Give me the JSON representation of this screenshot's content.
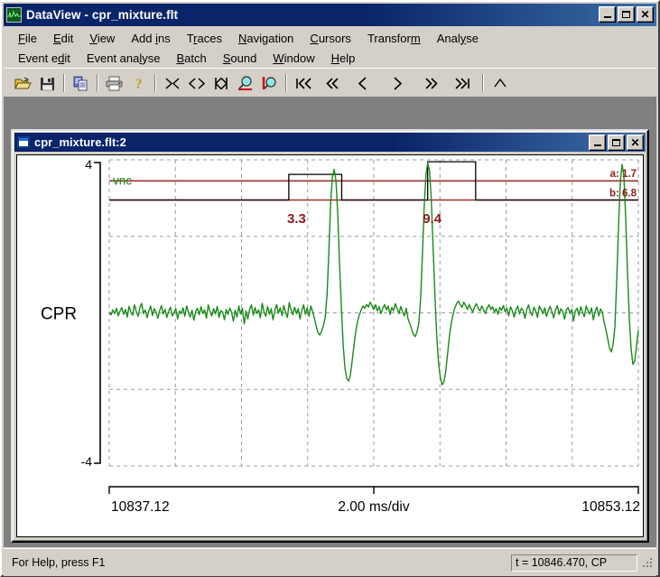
{
  "app": {
    "title": "DataView - cpr_mixture.flt",
    "icon": "waveform-icon"
  },
  "window_buttons": {
    "minimize": "_",
    "maximize": "□",
    "close": "✕"
  },
  "menu": {
    "row1": [
      {
        "label": "File",
        "accel": "F"
      },
      {
        "label": "Edit",
        "accel": "E"
      },
      {
        "label": "View",
        "accel": "V"
      },
      {
        "label": "Add ins",
        "accel": "i"
      },
      {
        "label": "Traces",
        "accel": "r"
      },
      {
        "label": "Navigation",
        "accel": "N"
      },
      {
        "label": "Cursors",
        "accel": "C"
      },
      {
        "label": "Transform",
        "accel": "m"
      },
      {
        "label": "Analyse",
        "accel": "y"
      }
    ],
    "row2": [
      {
        "label": "Event edit",
        "accel": "d"
      },
      {
        "label": "Event analyse",
        "accel": "l"
      },
      {
        "label": "Batch",
        "accel": "B"
      },
      {
        "label": "Sound",
        "accel": "S"
      },
      {
        "label": "Window",
        "accel": "W"
      },
      {
        "label": "Help",
        "accel": "H"
      }
    ]
  },
  "toolbar": {
    "buttons": [
      {
        "name": "open-file-icon",
        "kind": "icon"
      },
      {
        "name": "save-file-icon",
        "kind": "icon"
      },
      {
        "name": "separator",
        "kind": "sep"
      },
      {
        "name": "copy-icon",
        "kind": "icon"
      },
      {
        "name": "separator",
        "kind": "sep"
      },
      {
        "name": "print-icon",
        "kind": "icon"
      },
      {
        "name": "help-question-icon",
        "kind": "icon"
      },
      {
        "name": "separator",
        "kind": "sep"
      },
      {
        "name": "zoom-in-x-icon",
        "glyph": "><",
        "kind": "glyph"
      },
      {
        "name": "zoom-out-x-icon",
        "glyph": "<>",
        "kind": "glyph"
      },
      {
        "name": "fit-x-icon",
        "glyph": "K͆",
        "kind": "glyph"
      },
      {
        "name": "zoom-out-magnifier-icon",
        "kind": "icon"
      },
      {
        "name": "zoom-in-magnifier-icon",
        "kind": "icon"
      },
      {
        "name": "separator",
        "kind": "sep"
      },
      {
        "name": "go-first-icon",
        "glyph": "❘«",
        "kind": "glyph"
      },
      {
        "name": "page-back-icon",
        "glyph": "«",
        "kind": "glyph"
      },
      {
        "name": "step-back-icon",
        "glyph": "‹",
        "kind": "glyph"
      },
      {
        "name": "step-forward-icon",
        "glyph": "›",
        "kind": "glyph"
      },
      {
        "name": "page-forward-icon",
        "glyph": "»",
        "kind": "glyph"
      },
      {
        "name": "go-last-icon",
        "glyph": "»❘",
        "kind": "glyph"
      },
      {
        "name": "separator",
        "kind": "sep"
      },
      {
        "name": "chevron-up-icon",
        "glyph": "^",
        "kind": "glyph"
      }
    ]
  },
  "child_window": {
    "title": "cpr_mixture.flt:2",
    "icon": "document-window-icon"
  },
  "status": {
    "help_text": "For Help, press F1",
    "coordinate_text": "t = 10846.470, CP"
  },
  "chart_data": {
    "type": "line",
    "title": "",
    "ylabel": "CPR",
    "xlabel": "2.00  ms/div",
    "x_start_label": "10837.12",
    "x_end_label": "10853.12",
    "ms_per_div": "2.00  ms/div",
    "ylim": [
      -4,
      4
    ],
    "y_tick_labels": [
      "4",
      "-4"
    ],
    "xlim": [
      10837.12,
      10853.12
    ],
    "grid": true,
    "grid_x_divisions": 8,
    "grid_y_divisions": 4,
    "trace_name": "vnc",
    "trace_color": "#1a8a1a",
    "cursor_color": "#a03030",
    "event_color": "#000000",
    "label_color": "#8b1a1a",
    "event_labels": [
      {
        "text": "3.3",
        "t": 10842.5
      },
      {
        "text": "9.4",
        "t": 10846.6
      }
    ],
    "cursor_labels": [
      {
        "text": "a: 1.7",
        "y": 3.55
      },
      {
        "text": "b: 6.8",
        "y": 3.05
      }
    ],
    "cursor_lines_y": [
      3.45,
      2.95
    ],
    "event_pulses": [
      {
        "start": 10842.55,
        "end": 10844.15,
        "level_low": 2.95,
        "level_high": 3.62
      },
      {
        "start": 10846.75,
        "end": 10848.2,
        "level_low": 2.95,
        "level_high": 3.95
      }
    ],
    "waveform_note": "Noisy CPR neural recording with three large biphasic spikes",
    "series": [
      {
        "name": "CPR",
        "values": [
          0.02,
          -0.05,
          0.08,
          -0.02,
          0.12,
          -0.08,
          0.05,
          0.14,
          -0.04,
          0.09,
          -0.11,
          0.17,
          0.02,
          -0.06,
          0.21,
          0.04,
          -0.09,
          0.13,
          0.25,
          -0.02,
          0.08,
          -0.13,
          0.05,
          0.18,
          -0.07,
          0.11,
          0.02,
          -0.14,
          0.06,
          0.19,
          -0.03,
          0.09,
          -0.12,
          0.04,
          0.15,
          -0.08,
          0.02,
          0.11,
          -0.16,
          0.05,
          -0.02,
          0.13,
          -0.09,
          0.18,
          0.01,
          -0.11,
          0.07,
          -0.19,
          0.03,
          0.12,
          -0.05,
          0.16,
          -0.02,
          0.08,
          -0.14,
          0.21,
          0.04,
          -0.08,
          0.11,
          -0.03,
          0.17,
          -0.12,
          0.06,
          0.02,
          -0.18,
          0.09,
          -0.04,
          0.13,
          0.01,
          -0.22,
          0.07,
          -0.11,
          0.18,
          -0.03,
          0.12,
          -0.29,
          0.05,
          -0.16,
          0.09,
          0.21,
          -0.06,
          0.14,
          -0.02,
          0.08,
          -0.13,
          0.25,
          0.03,
          -0.09,
          0.17,
          -0.04,
          0.11,
          -0.18,
          0.06,
          0.22,
          -0.01,
          0.13,
          -0.07,
          0.19,
          0.02,
          -0.12,
          0.27,
          0.08,
          -0.05,
          0.15,
          -0.02,
          0.11,
          -0.16,
          0.06,
          0.21,
          -0.04,
          0.13,
          -0.09,
          0.18,
          0.03,
          -0.14,
          -0.35,
          -0.52,
          -0.58,
          -0.48,
          -0.33,
          -0.12,
          0.45,
          1.55,
          2.85,
          3.55,
          3.75,
          3.45,
          2.55,
          1.25,
          0.15,
          -0.85,
          -1.45,
          -1.72,
          -1.78,
          -1.62,
          -1.25,
          -0.85,
          -0.48,
          -0.22,
          -0.05,
          0.08,
          0.18,
          0.12,
          0.22,
          0.15,
          0.28,
          0.18,
          0.09,
          0.21,
          0.05,
          0.16,
          -0.02,
          0.12,
          0.22,
          0.08,
          0.18,
          -0.04,
          0.14,
          0.06,
          0.24,
          0.11,
          -0.02,
          0.17,
          0.03,
          -0.08,
          0.12,
          -0.15,
          -0.28,
          -0.42,
          -0.56,
          -0.62,
          -0.5,
          -0.28,
          0.35,
          1.48,
          2.78,
          3.62,
          3.92,
          3.7,
          2.92,
          1.65,
          0.42,
          -0.62,
          -1.32,
          -1.7,
          -1.88,
          -1.8,
          -1.52,
          -1.08,
          -0.62,
          -0.28,
          -0.05,
          0.12,
          0.24,
          0.31,
          0.22,
          0.14,
          0.28,
          0.19,
          0.09,
          0.22,
          0.11,
          0.02,
          0.15,
          0.24,
          0.12,
          0.05,
          0.18,
          0.08,
          -0.02,
          0.13,
          0.21,
          0.09,
          0.16,
          0.02,
          0.11,
          -0.04,
          0.14,
          0.07,
          0.19,
          0.03,
          0.12,
          -0.08,
          0.16,
          0.05,
          -0.11,
          0.08,
          0.18,
          -0.03,
          0.12,
          0.06,
          -0.14,
          0.09,
          0.21,
          0.02,
          -0.07,
          0.15,
          0.04,
          -0.12,
          0.18,
          0.08,
          -0.02,
          0.13,
          -0.09,
          0.06,
          0.17,
          0.02,
          -0.13,
          0.08,
          0.19,
          -0.04,
          0.11,
          0.03,
          -0.16,
          0.07,
          0.14,
          -0.02,
          0.09,
          -0.21,
          0.05,
          0.12,
          -0.06,
          0.16,
          0.02,
          -0.1,
          0.18,
          0.06,
          -0.03,
          0.13,
          -0.18,
          0.04,
          0.15,
          -0.08,
          0.1,
          0.02,
          -0.25,
          -0.45,
          -0.68,
          -0.92,
          -1.02,
          -0.82,
          -0.35,
          0.85,
          2.25,
          3.45,
          3.88,
          3.55,
          2.45,
          1.05,
          -0.15,
          -0.95,
          -1.35,
          -1.25,
          -0.85,
          -0.45
        ]
      }
    ]
  }
}
